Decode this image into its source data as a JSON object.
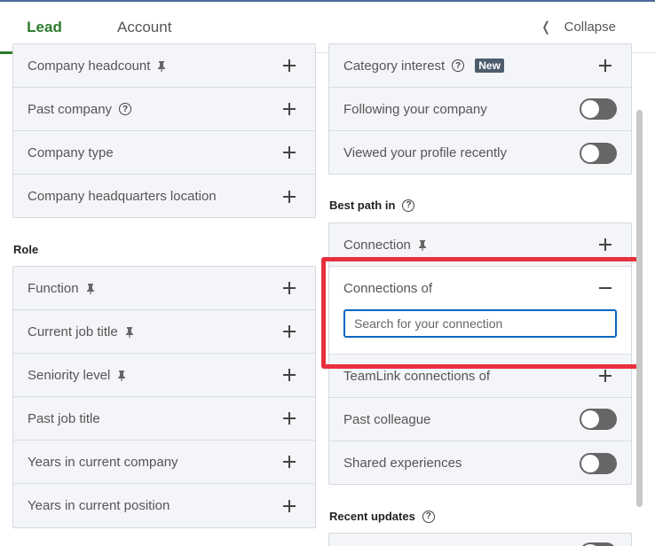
{
  "tabs": {
    "lead": "Lead",
    "account": "Account",
    "collapse": "Collapse"
  },
  "left": {
    "company_rows": [
      "Company headcount",
      "Past company",
      "Company type",
      "Company headquarters location"
    ],
    "role_title": "Role",
    "role_rows": [
      "Function",
      "Current job title",
      "Seniority level",
      "Past job title",
      "Years in current company",
      "Years in current position"
    ]
  },
  "right": {
    "top_rows": {
      "category_interest": "Category interest",
      "new_badge": "New",
      "following": "Following your company",
      "viewed": "Viewed your profile recently"
    },
    "best_path_title": "Best path in",
    "best_path": {
      "connection": "Connection",
      "connections_of": "Connections of",
      "search_placeholder": "Search for your connection",
      "teamlink": "TeamLink connections of",
      "past_colleague": "Past colleague",
      "shared": "Shared experiences"
    },
    "recent_updates_title": "Recent updates"
  },
  "colors": {
    "accent": "#2c7b2c",
    "focus": "#0a66c2",
    "highlight": "#e8303d"
  }
}
